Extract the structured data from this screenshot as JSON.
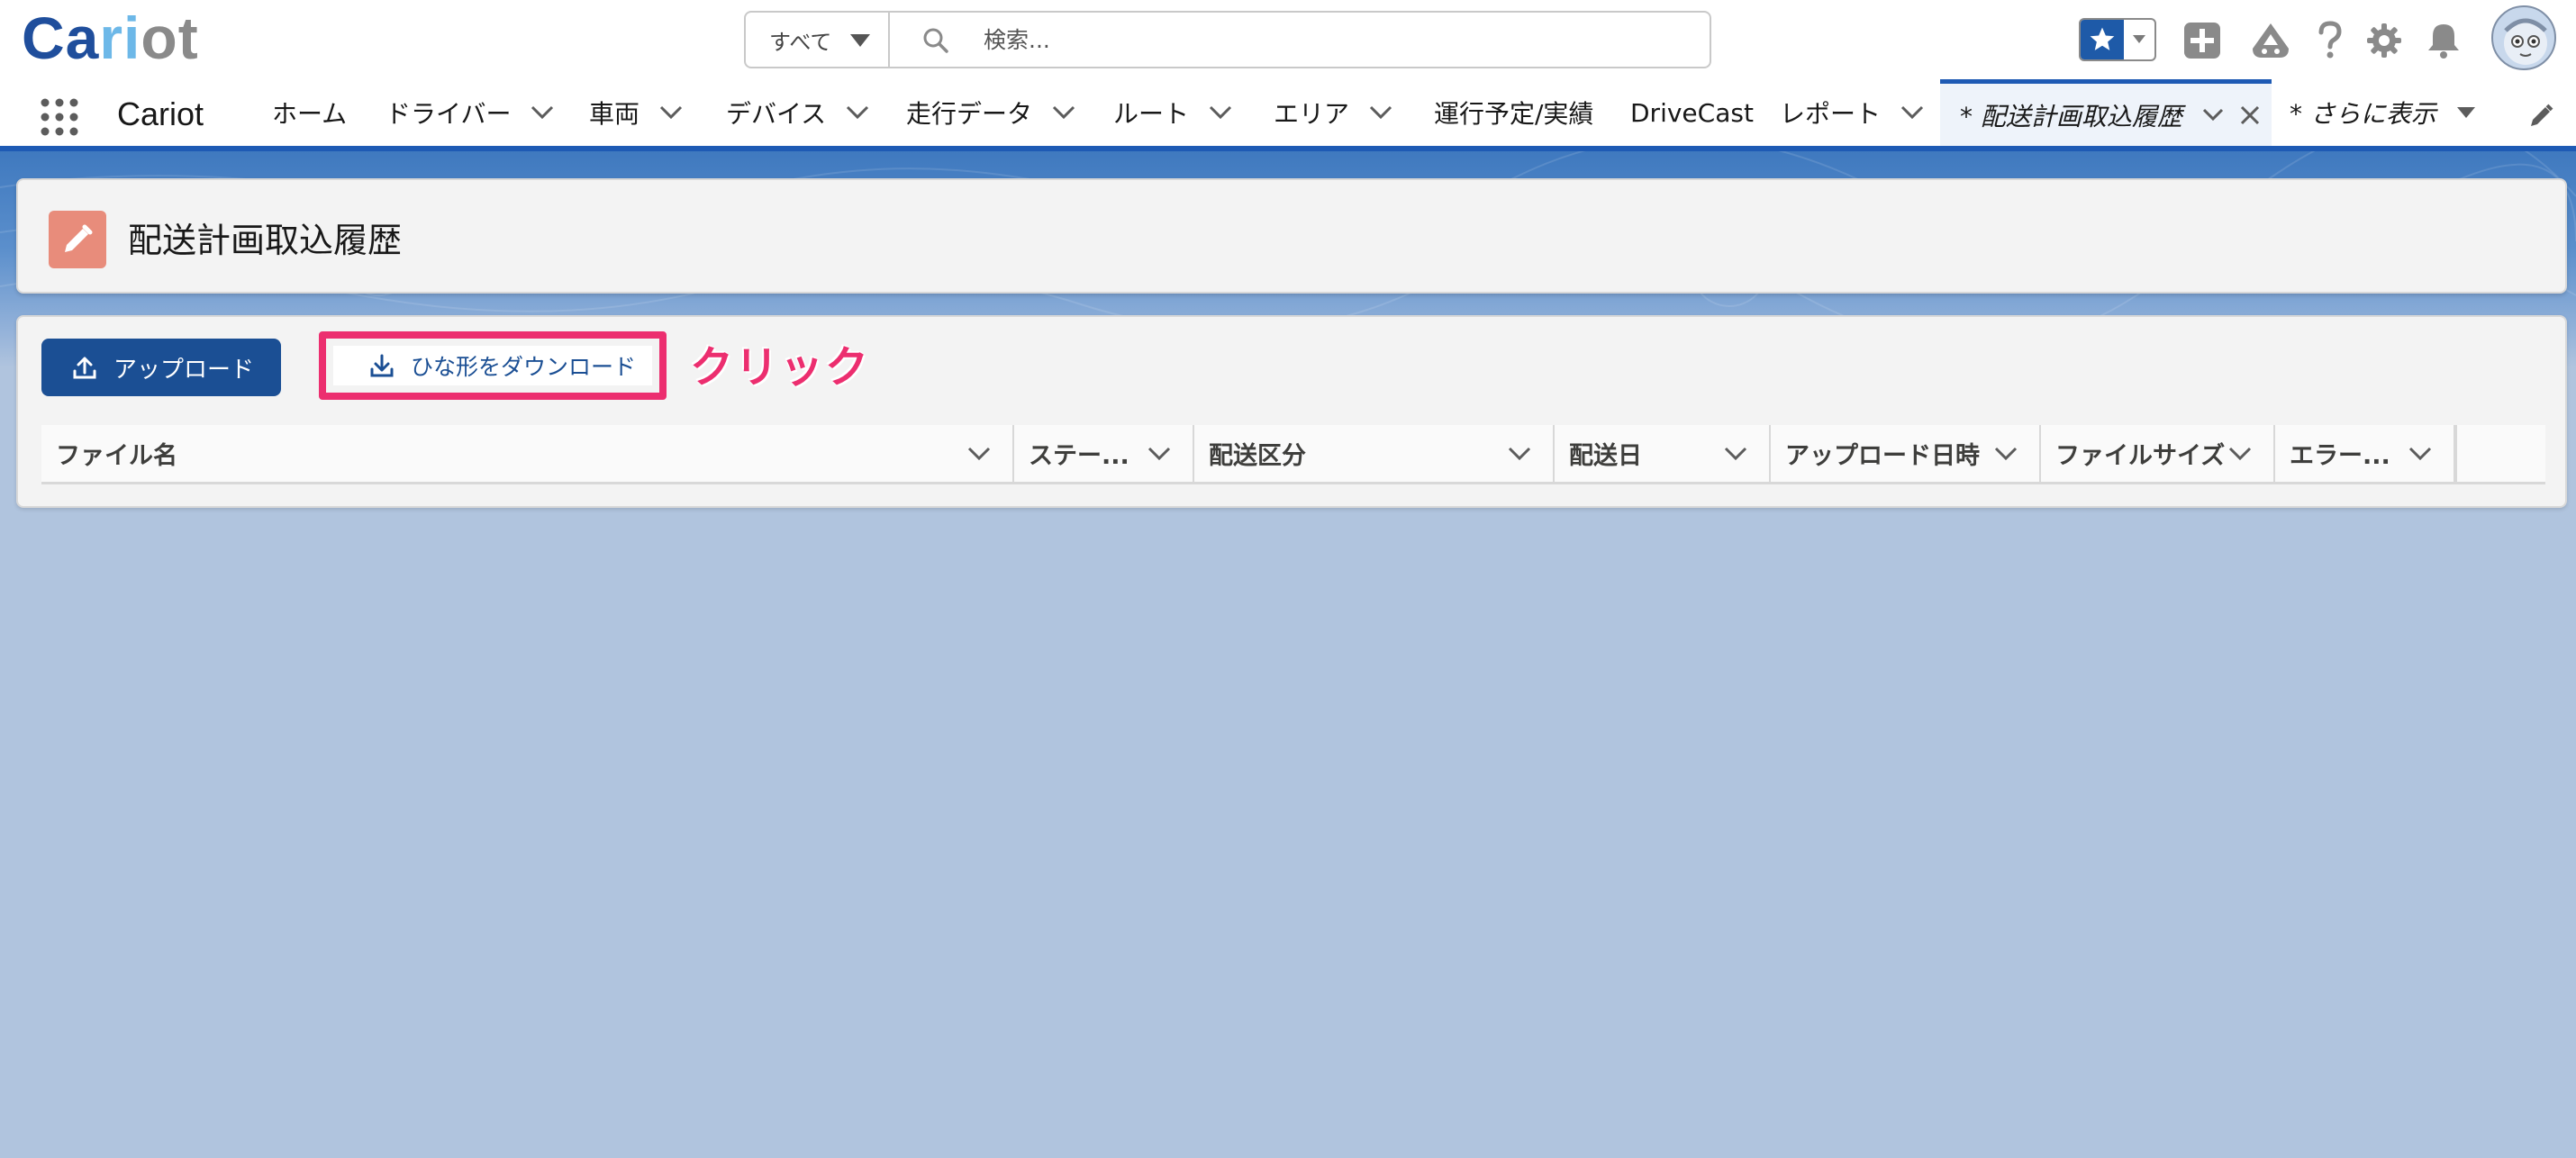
{
  "brand": {
    "logo_parts": [
      "Ca",
      "ri",
      "ot"
    ],
    "app_name": "Cariot"
  },
  "search": {
    "scope": "すべて",
    "placeholder": "検索..."
  },
  "nav": {
    "items": [
      {
        "label": "ホーム",
        "has_menu": false
      },
      {
        "label": "ドライバー",
        "has_menu": true
      },
      {
        "label": "車両",
        "has_menu": true
      },
      {
        "label": "デバイス",
        "has_menu": true
      },
      {
        "label": "走行データ",
        "has_menu": true
      },
      {
        "label": "ルート",
        "has_menu": true
      },
      {
        "label": "エリア",
        "has_menu": true
      },
      {
        "label": "運行予定/実績",
        "has_menu": false
      },
      {
        "label": "DriveCast",
        "has_menu": false
      },
      {
        "label": "レポート",
        "has_menu": true
      }
    ],
    "active_tab": "* 配送計画取込履歴",
    "more": "* さらに表示"
  },
  "page": {
    "title": "配送計画取込履歴",
    "icon": "pencil-icon"
  },
  "toolbar": {
    "upload_label": "アップロード",
    "template_label": "ひな形をダウンロード",
    "annotation": "クリック"
  },
  "table": {
    "columns": [
      "ファイル名",
      "ステー...",
      "配送区分",
      "配送日",
      "アップロード日時",
      "ファイルサイズ",
      "エラー..."
    ]
  },
  "colors": {
    "brand_blue": "#1b4f94",
    "highlight_pink": "#ec2e6f",
    "nav_active": "#1e5ab4",
    "page_icon_bg": "#e88c7b",
    "background": "#b0c4de"
  }
}
